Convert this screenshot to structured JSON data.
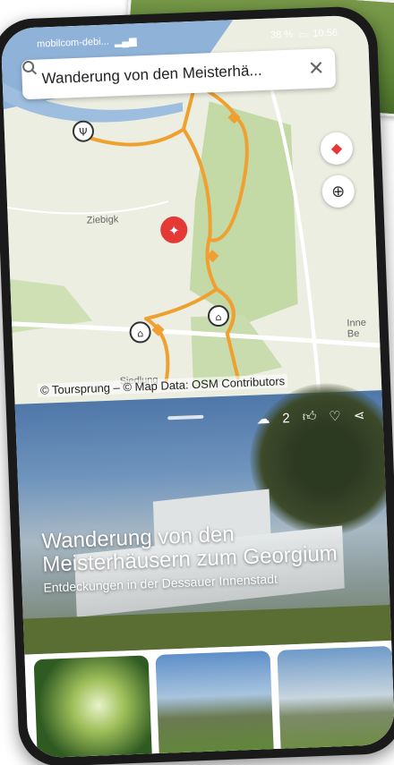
{
  "status_bar": {
    "carrier": "mobilcom-debi...",
    "battery_percent": "38 %",
    "time": "10:56"
  },
  "search": {
    "query": "Wanderung von den Meisterhä...",
    "search_icon": "search-icon",
    "close_icon": "close-icon"
  },
  "map": {
    "places": [
      "Ziebigk",
      "Siedlung",
      "Inne Be"
    ],
    "attribution": "© Toursprung – © Map Data: OSM Contributors",
    "colors": {
      "route": "#f0a030",
      "water": "#a9c7e6",
      "park": "#c9dcae",
      "marker": "#e53935"
    }
  },
  "card": {
    "title": "Wanderung von den Meisterhäusern zum Georgium",
    "subtitle": "Entdeckungen in der Dessauer Innenstadt",
    "download_count": "2",
    "icons": [
      "cloud-download-icon",
      "thumbs-up-icon",
      "heart-icon",
      "share-icon"
    ]
  },
  "thumbnails": [
    "photo-temple",
    "photo-meisterhaus",
    "photo-building"
  ]
}
